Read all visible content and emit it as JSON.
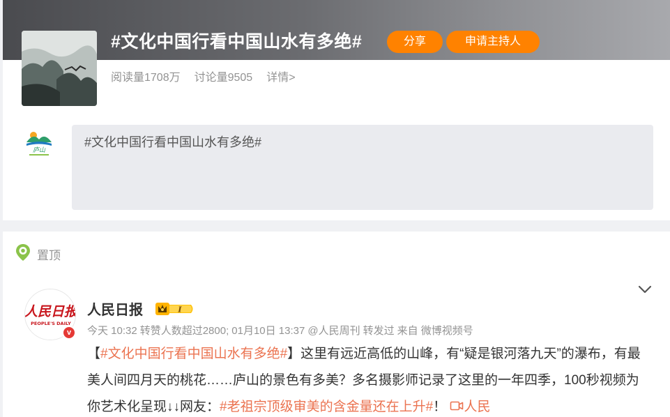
{
  "topic": {
    "title": "#文化中国行看中国山水有多绝#",
    "share_label": "分享",
    "host_label": "申请主持人",
    "reads": "阅读量1708万",
    "discussions": "讨论量9505",
    "details": "详情>"
  },
  "composer": {
    "text": "#文化中国行看中国山水有多绝#"
  },
  "feed": {
    "pin_label": "置顶",
    "post": {
      "author": "人民日报",
      "vip_level": "I",
      "meta": {
        "time": "今天 10:32",
        "likes_note": "转赞人数超过2800;",
        "orig_time": "01月10日 13:37",
        "orig_author": "@人民周刊",
        "repost_note": "转发过",
        "source": "来自 微博视频号"
      },
      "body": {
        "open_bracket": "【",
        "hashtag1": "#文化中国行看中国山水有多绝#",
        "text1": "】这里有远近高低的山峰，有“疑是银河落九天”的瀑布，有最美人间四月天的桃花……庐山的景色有多美？多名摄影师记录了这里的一年四季，100秒视频为你艺术化呈现↓↓网友：",
        "hashtag2": "#老祖宗顶级审美的含金量还在上升#",
        "text2": "！",
        "video_link": "人民"
      },
      "logo_text_cn": "人民日报",
      "logo_text_en": "PEOPLE'S DAILY"
    }
  },
  "colors": {
    "accent": "#ff8200",
    "hashtag": "#eb7350",
    "muted": "#939393",
    "verified": "#e53935"
  }
}
